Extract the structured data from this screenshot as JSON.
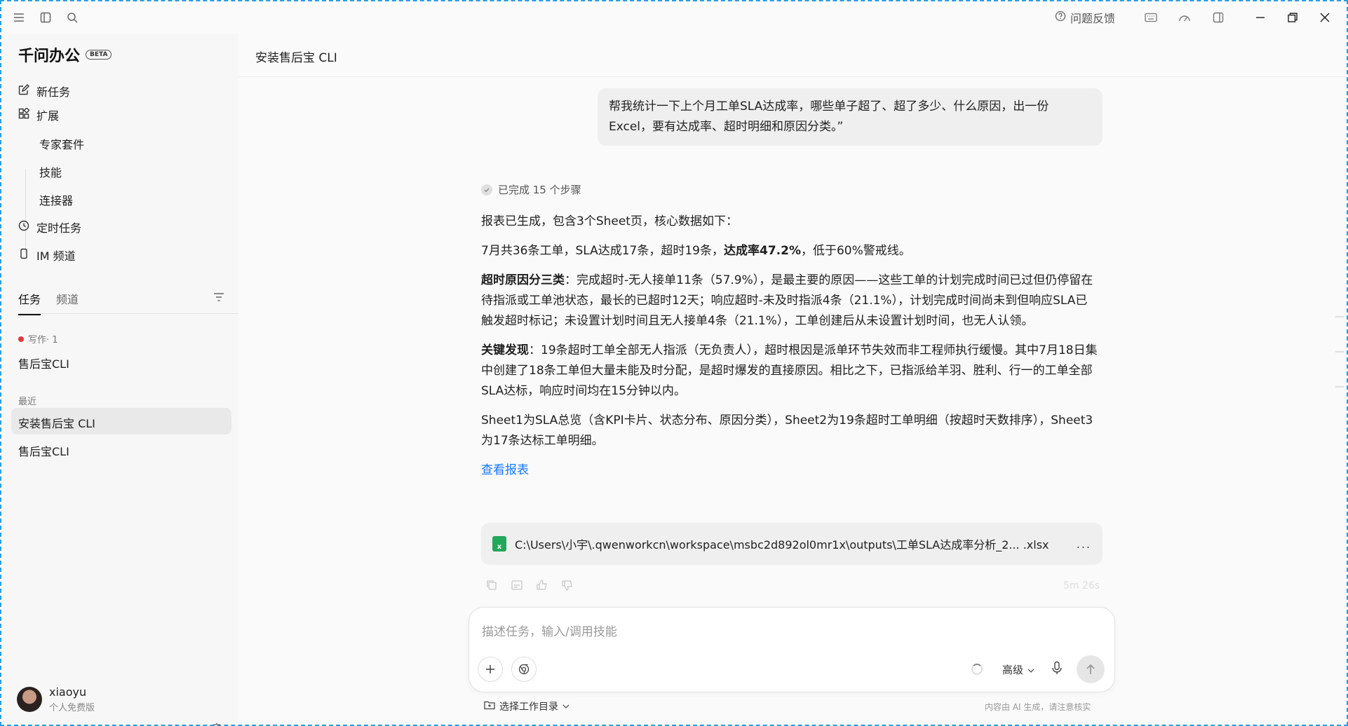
{
  "titlebar": {
    "feedback_label": "问题反馈",
    "icons": [
      "menu-icon",
      "sidebar-toggle-icon",
      "search-icon",
      "keyboard-icon",
      "speed-icon",
      "layout-icon",
      "minimize-icon",
      "restore-icon",
      "close-icon"
    ]
  },
  "sidebar": {
    "brand": "千问办公",
    "badge": "BETA",
    "nav": {
      "new_task": "新任务",
      "extend": "扩展",
      "expert_kit": "专家套件",
      "skills": "技能",
      "connectors": "连接器",
      "scheduled": "定时任务",
      "im_channel": "IM 频道"
    },
    "tabs": {
      "tasks": "任务",
      "channels": "频道"
    },
    "group_writing": "写作· 1",
    "writing_items": [
      "售后宝CLI"
    ],
    "group_recent": "最近",
    "recent_items": [
      "安装售后宝 CLI",
      "售后宝CLI"
    ],
    "user": {
      "name": "xiaoyu",
      "plan": "个人免费版"
    }
  },
  "main": {
    "title": "安装售后宝 CLI",
    "user_message": "帮我统计一下上个月工单SLA达成率，哪些单子超了、超了多少、什么原因，出一份Excel，要有达成率、超时明细和原因分类。”",
    "steps_label": "已完成 15 个步骤",
    "answer": {
      "p1": "报表已生成，包含3个Sheet页，核心数据如下：",
      "p2_pre": "7月共36条工单，SLA达成17条，超时19条，",
      "p2_bold": "达成率47.2%",
      "p2_post": "，低于60%警戒线。",
      "p3_bold": "超时原因分三类",
      "p3_text": "：完成超时-无人接单11条（57.9%），是最主要的原因——这些工单的计划完成时间已过但仍停留在待指派或工单池状态，最长的已超时12天；响应超时-未及时指派4条（21.1%），计划完成时间尚未到但响应SLA已触发超时标记；未设置计划时间且无人接单4条（21.1%），工单创建后从未设置计划时间，也无人认领。",
      "p4_bold": "关键发现",
      "p4_text": "：19条超时工单全部无人指派（无负责人），超时根因是派单环节失效而非工程师执行缓慢。其中7月18日集中创建了18条工单但大量未能及时分配，是超时爆发的直接原因。相比之下，已指派给羊羽、胜利、行一的工单全部SLA达标，响应时间均在15分钟以内。",
      "p5": "Sheet1为SLA总览（含KPI卡片、状态分布、原因分类），Sheet2为19条超时工单明细（按超时天数排序），Sheet3为17条达标工单明细。",
      "link": "查看报表"
    },
    "file": {
      "icon_letter": "x",
      "path": "C:\\Users\\小宇\\.qwenworkcn\\workspace\\msbc2d892ol0mr1x\\outputs\\工单SLA达成率分析_2... .xlsx",
      "more": "..."
    },
    "elapsed": "5m 26s",
    "composer": {
      "placeholder": "描述任务，输入/调用技能",
      "level_label": "高级"
    },
    "workdir_label": "选择工作目录",
    "disclaimer": "内容由 AI 生成，请注意核实"
  }
}
